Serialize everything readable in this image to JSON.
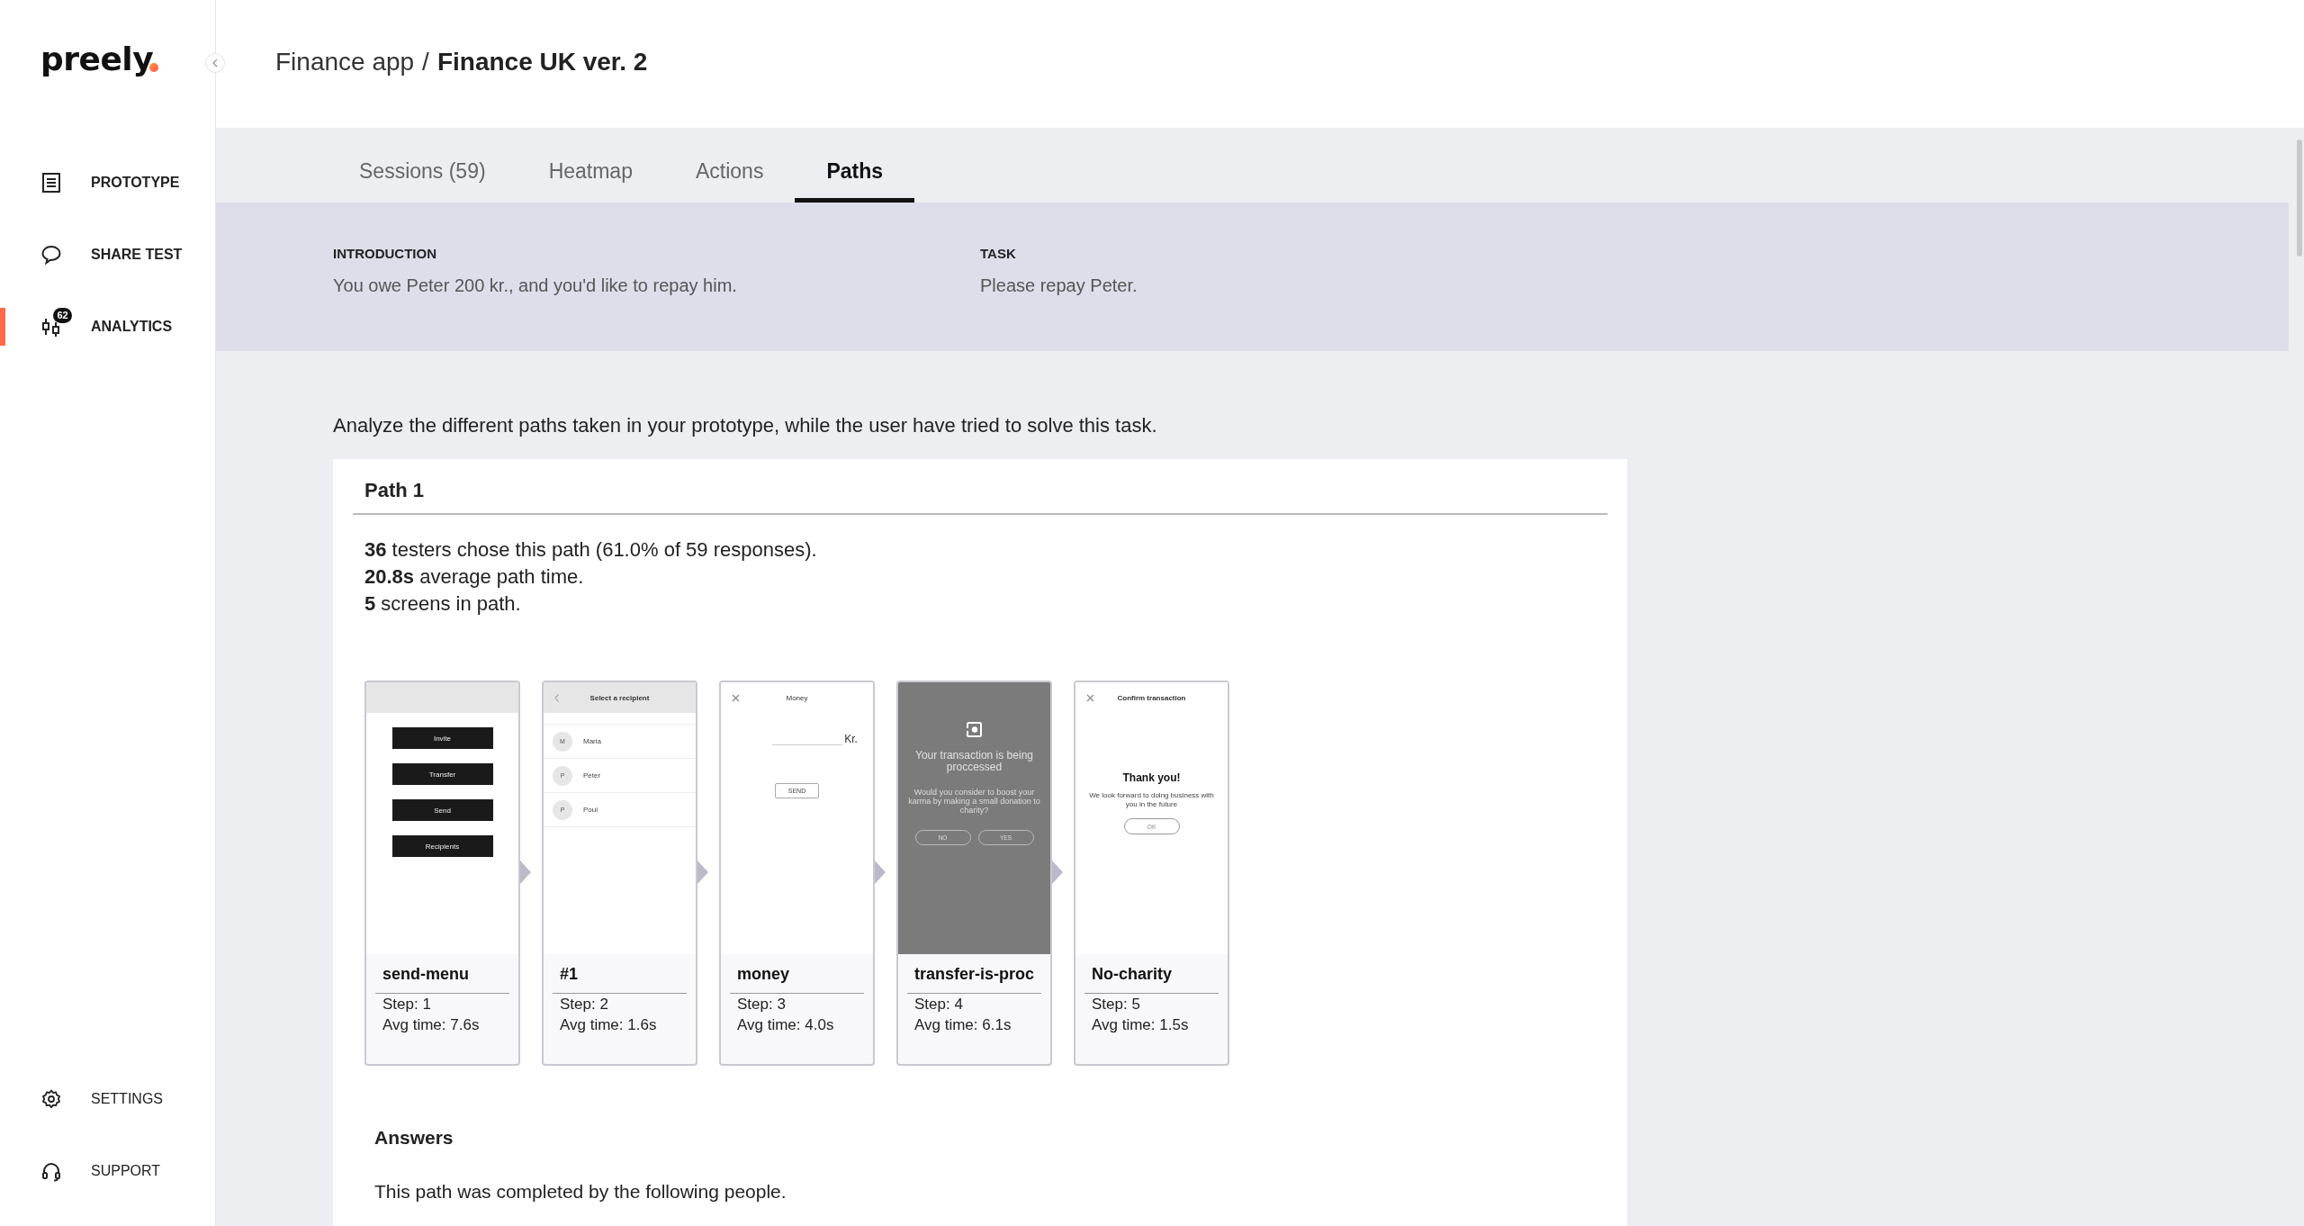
{
  "logo": "preely",
  "nav": [
    {
      "label": "PROTOTYPE",
      "selected": false
    },
    {
      "label": "SHARE TEST",
      "selected": false
    },
    {
      "label": "ANALYTICS",
      "selected": true,
      "badge": "62"
    }
  ],
  "nav_bottom": [
    {
      "label": "SETTINGS"
    },
    {
      "label": "SUPPORT"
    }
  ],
  "breadcrumb": {
    "parent": "Finance app",
    "separator": "/",
    "current": "Finance UK ver. 2"
  },
  "tabs": [
    {
      "label": "Sessions (59)",
      "selected": false
    },
    {
      "label": "Heatmap",
      "selected": false
    },
    {
      "label": "Actions",
      "selected": false
    },
    {
      "label": "Paths",
      "selected": true
    }
  ],
  "introduction": {
    "heading": "INTRODUCTION",
    "text": "You owe Peter 200 kr., and you'd like to repay him."
  },
  "task": {
    "heading": "TASK",
    "text": "Please repay Peter."
  },
  "instruction": "Analyze the different paths taken in your prototype, while the user have tried to solve this task.",
  "path": {
    "title": "Path 1",
    "stats": [
      "**36** testers chose this path (61.0% of 59 responses).",
      "**20.8s** average path time.",
      "**5** screens in path."
    ],
    "screens": [
      {
        "name": "send-menu",
        "step": "Step: 1",
        "avg_time": "Avg time: 7.6s",
        "preview": {
          "kind": "menu",
          "buttons": [
            "Invite",
            "Transfer",
            "Send",
            "Recipients"
          ]
        }
      },
      {
        "name": "#1",
        "step": "Step: 2",
        "avg_time": "Avg time: 1.6s",
        "preview": {
          "kind": "list",
          "title": "Select a recipient",
          "contacts": [
            {
              "initial": "M",
              "name": "Maria"
            },
            {
              "initial": "P",
              "name": "Peter"
            },
            {
              "initial": "P",
              "name": "Poul"
            }
          ]
        }
      },
      {
        "name": "money",
        "step": "Step: 3",
        "avg_time": "Avg time: 4.0s",
        "preview": {
          "kind": "amount",
          "title": "Money",
          "currency": "Kr.",
          "button": "SEND"
        }
      },
      {
        "name": "transfer-is-proc",
        "step": "Step: 4",
        "avg_time": "Avg time: 6.1s",
        "preview": {
          "kind": "processing",
          "heading": "Your transaction is being proccessed",
          "question": "Would you consider to boost your karma by making a small donation to charity?",
          "buttons": [
            "NO",
            "YES"
          ]
        }
      },
      {
        "name": "No-charity",
        "step": "Step: 5",
        "avg_time": "Avg time: 1.5s",
        "preview": {
          "kind": "confirm",
          "title": "Confirm transaction",
          "heading": "Thank you!",
          "text": "We look forward to doing business with you in the future",
          "button": "OK"
        }
      }
    ],
    "answers": {
      "heading": "Answers",
      "text": "This path was completed by the following people."
    }
  }
}
